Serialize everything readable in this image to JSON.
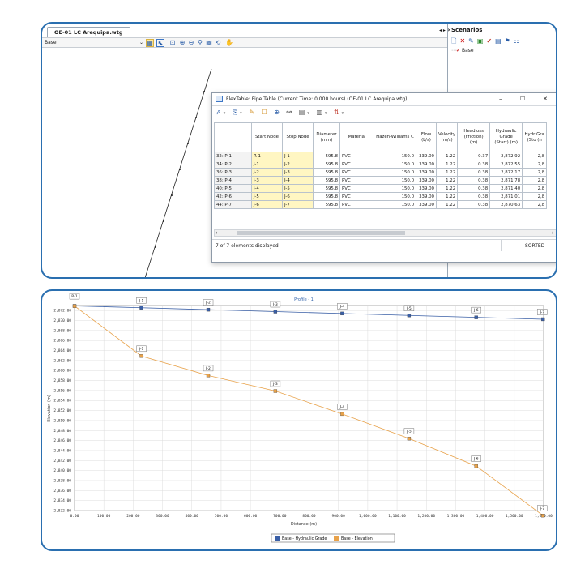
{
  "topwin": {
    "tab": "OE-01 LC Arequipa.wtg",
    "nav": "◂ ▸ ✕",
    "base_label": "Base",
    "scenarios_title": "Scenarios",
    "scenario_item": "Base"
  },
  "flextable": {
    "title": "FlexTable: Pipe Table (Current Time: 0.000 hours) (OE-01 LC Arequipa.wtg)",
    "minimize": "–",
    "maximize": "☐",
    "close": "✕",
    "headers": [
      "",
      "Start Node",
      "Stop Node",
      "Diameter (mm)",
      "Material",
      "Hazen-Williams C",
      "Flow (L/s)",
      "Velocity (m/s)",
      "Headloss (Friction) (m)",
      "Hydraulic Grade (Start) (m)",
      "Hydr Gra (Sto (n"
    ],
    "rows": [
      [
        "32: P-1",
        "R-1",
        "J-1",
        "595.8",
        "PVC",
        "150.0",
        "339.00",
        "1.22",
        "0.37",
        "2,872.92",
        "2,8"
      ],
      [
        "34: P-2",
        "J-1",
        "J-2",
        "595.8",
        "PVC",
        "150.0",
        "339.00",
        "1.22",
        "0.38",
        "2,872.55",
        "2,8"
      ],
      [
        "36: P-3",
        "J-2",
        "J-3",
        "595.8",
        "PVC",
        "150.0",
        "339.00",
        "1.22",
        "0.38",
        "2,872.17",
        "2,8"
      ],
      [
        "38: P-4",
        "J-3",
        "J-4",
        "595.8",
        "PVC",
        "150.0",
        "339.00",
        "1.22",
        "0.38",
        "2,871.78",
        "2,8"
      ],
      [
        "40: P-5",
        "J-4",
        "J-5",
        "595.8",
        "PVC",
        "150.0",
        "339.00",
        "1.22",
        "0.38",
        "2,871.40",
        "2,8"
      ],
      [
        "42: P-6",
        "J-5",
        "J-6",
        "595.8",
        "PVC",
        "150.0",
        "339.00",
        "1.22",
        "0.38",
        "2,871.01",
        "2,8"
      ],
      [
        "44: P-7",
        "J-6",
        "J-7",
        "595.8",
        "PVC",
        "150.0",
        "339.00",
        "1.22",
        "0.38",
        "2,870.63",
        "2,8"
      ]
    ],
    "status": "7 of 7 elements displayed",
    "sorted": "SORTED"
  },
  "chart_data": {
    "type": "line",
    "title": "Profile - 1",
    "xlabel": "Distance (m)",
    "ylabel": "Elevation (m)",
    "xlim": [
      0,
      1600
    ],
    "ylim": [
      2832,
      2873
    ],
    "xticks": [
      "0.00",
      "100.00",
      "200.00",
      "300.00",
      "400.00",
      "500.00",
      "600.00",
      "700.00",
      "800.00",
      "900.00",
      "1,000.00",
      "1,100.00",
      "1,200.00",
      "1,300.00",
      "1,400.00",
      "1,500.00",
      "1,600.00"
    ],
    "yticks": [
      "2,872.00",
      "2,870.00",
      "2,868.00",
      "2,866.00",
      "2,864.00",
      "2,862.00",
      "2,860.00",
      "2,858.00",
      "2,856.00",
      "2,854.00",
      "2,852.00",
      "2,850.00",
      "2,848.00",
      "2,846.00",
      "2,844.00",
      "2,842.00",
      "2,840.00",
      "2,838.00",
      "2,836.00",
      "2,834.00",
      "2,832.00"
    ],
    "grid": true,
    "legend": "bottom-center",
    "series": [
      {
        "name": "Base - Hydraulic Grade",
        "color": "#3a5fa6",
        "x": [
          0,
          228,
          456,
          685,
          913,
          1141,
          1370,
          1598
        ],
        "y": [
          2872.92,
          2872.55,
          2872.17,
          2871.78,
          2871.4,
          2871.01,
          2870.63,
          2870.25
        ],
        "labels": [
          "J-1",
          "J-2",
          "J-3",
          "J-4",
          "J-5",
          "J-6",
          "J-7"
        ]
      },
      {
        "name": "Base - Elevation",
        "color": "#e8a24a",
        "x": [
          0,
          228,
          456,
          685,
          913,
          1141,
          1370,
          1598
        ],
        "y": [
          2872.9,
          2862.9,
          2859.0,
          2855.9,
          2851.3,
          2846.4,
          2840.9,
          2831.0
        ],
        "labels": [
          "R-1",
          "J-1",
          "J-2",
          "J-3",
          "J-4",
          "J-5",
          "J-6",
          "J-7"
        ]
      }
    ]
  }
}
